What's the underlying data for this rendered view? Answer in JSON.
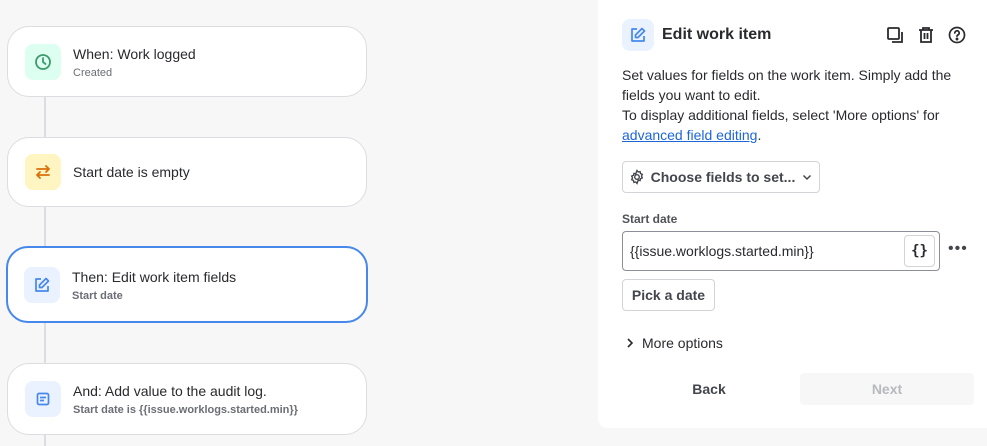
{
  "flow": [
    {
      "title": "When: Work logged",
      "subtitle": "Created",
      "icon": "clock-icon",
      "color": "#3d9a6a",
      "bg": "#dcfff1"
    },
    {
      "title": "Start date is empty",
      "icon": "swap-arrows-icon",
      "color": "#d97008",
      "bg": "#fff5c2"
    },
    {
      "title": "Then: Edit work item fields",
      "subtitle": "Start date",
      "icon": "edit-icon",
      "color": "#4688ec",
      "bg": "#e9f2fe"
    },
    {
      "title": "And: Add value to the audit log.",
      "subtitle": "Start date is {{issue.worklogs.started.min}}",
      "icon": "log-icon",
      "color": "#4688ec",
      "bg": "#e9f2fe"
    }
  ],
  "panel": {
    "title": "Edit work item",
    "desc1": "Set values for fields on the work item. Simply add the fields you want to edit.",
    "desc2": "To display additional fields, select 'More options' for ",
    "link": "advanced field editing",
    "desc_end": ".",
    "choose": "Choose fields to set...",
    "field_label": "Start date",
    "field_value": "{{issue.worklogs.started.min}}",
    "braces": "{}",
    "pick": "Pick a date",
    "more": "More options",
    "back": "Back",
    "next": "Next"
  }
}
